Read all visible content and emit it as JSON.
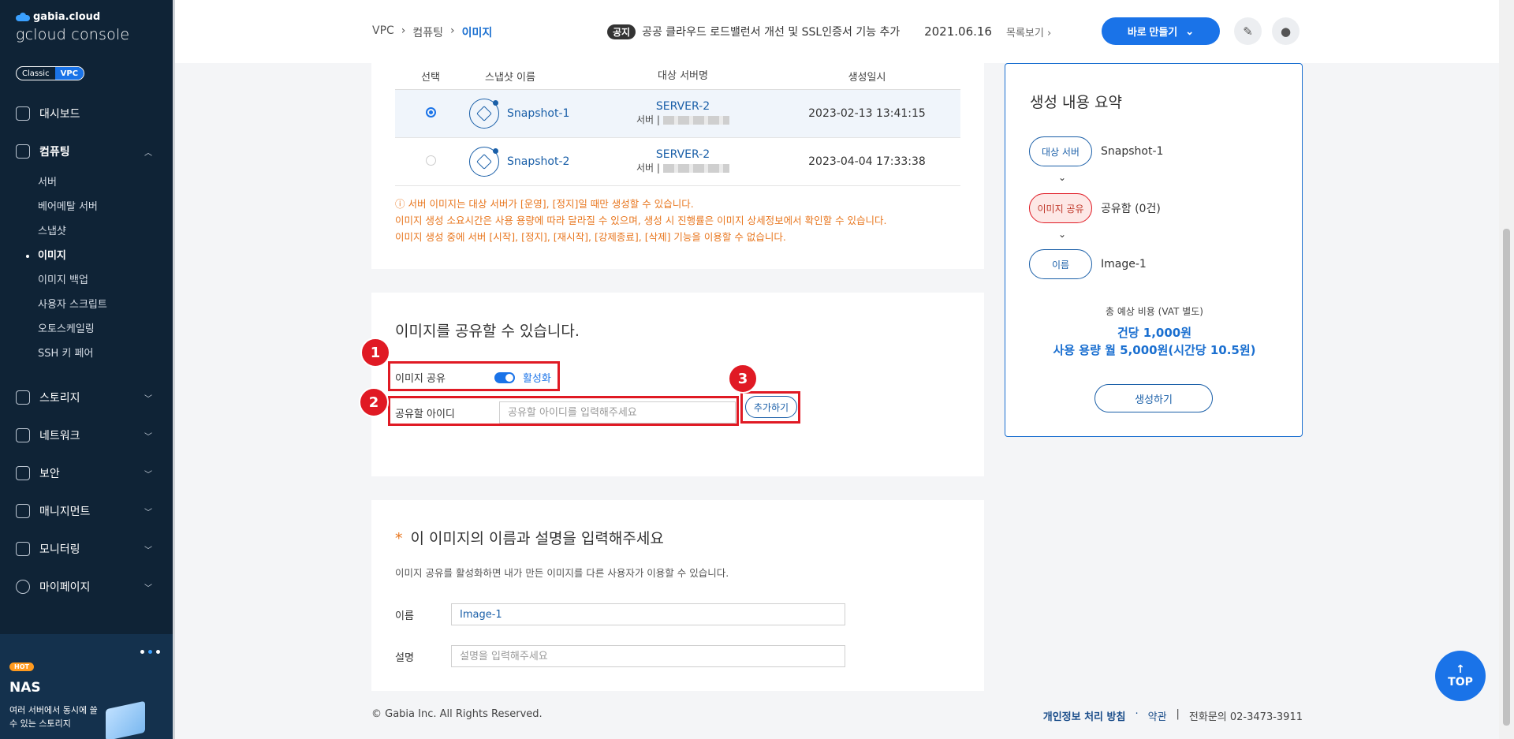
{
  "brand": {
    "small": "gabia.cloud",
    "big": "gcloud console"
  },
  "mode": {
    "classic": "Classic",
    "vpc": "VPC"
  },
  "nav": {
    "dashboard": "대시보드",
    "computing": "컴퓨팅",
    "sub": [
      "서버",
      "베어메탈 서버",
      "스냅샷",
      "이미지",
      "이미지 백업",
      "사용자 스크립트",
      "오토스케일링",
      "SSH 키 페어"
    ],
    "storage": "스토리지",
    "network": "네트워크",
    "security": "보안",
    "management": "매니지먼트",
    "monitoring": "모니터링",
    "mypage": "마이페이지"
  },
  "promo": {
    "badge": "HOT",
    "title": "NAS",
    "desc": "여러 서버에서 동시에 쓸 수 있는 스토리지"
  },
  "breadcrumb": [
    "VPC",
    "컴퓨팅",
    "이미지"
  ],
  "notice": {
    "badge": "공지",
    "text": "공공 클라우드 로드밸런서 개선 및 SSL인증서 기능 추가",
    "date": "2021.06.16",
    "more": "목록보기"
  },
  "header": {
    "create_button": "바로 만들기"
  },
  "table": {
    "headers": [
      "선택",
      "스냅샷 이름",
      "대상 서버명",
      "생성일시"
    ],
    "rows": [
      {
        "name": "Snapshot-1",
        "server": "SERVER-2",
        "server_sub": "서버 |",
        "created": "2023-02-13 13:41:15"
      },
      {
        "name": "Snapshot-2",
        "server": "SERVER-2",
        "server_sub": "서버 |",
        "created": "2023-04-04 17:33:38"
      }
    ]
  },
  "warnings": [
    "ⓘ 서버 이미지는 대상 서버가 [운영], [정지]일 때만 생성할 수 있습니다.",
    "이미지 생성 소요시간은 사용 용량에 따라 달라질 수 있으며, 생성 시 진행률은 이미지 상세정보에서 확인할 수 있습니다.",
    "이미지 생성 중에 서버 [시작], [정지], [재시작], [강제종료], [삭제] 기능을 이용할 수 없습니다."
  ],
  "share": {
    "title": "이미지를 공유할 수 있습니다.",
    "toggle_label": "이미지 공유",
    "toggle_state": "활성화",
    "id_label": "공유할 아이디",
    "id_placeholder": "공유할 아이디를 입력해주세요",
    "add_button": "추가하기",
    "badges": [
      "1",
      "2",
      "3"
    ]
  },
  "name_section": {
    "star": "*",
    "title": "이 이미지의 이름과 설명을 입력해주세요",
    "desc": "이미지 공유를 활성화하면 내가 만든 이미지를 다른 사용자가 이용할 수 있습니다.",
    "name_label": "이름",
    "name_value": "Image-1",
    "desc_label": "설명",
    "desc_placeholder": "설명을 입력해주세요"
  },
  "summary": {
    "title": "생성 내용 요약",
    "steps": [
      {
        "pill": "대상 서버",
        "value": "Snapshot-1"
      },
      {
        "pill": "이미지 공유",
        "value": "공유함 (0건)"
      },
      {
        "pill": "이름",
        "value": "Image-1"
      }
    ],
    "cost_label": "총 예상 비용 (VAT 별도)",
    "cost_1": "건당 1,000원",
    "cost_2": "사용 용량 월 5,000원(시간당 10.5원)",
    "button": "생성하기"
  },
  "footer": {
    "copyright": "© Gabia Inc. All Rights Reserved.",
    "privacy": "개인정보 처리 방침",
    "dot": "·",
    "terms": "약관",
    "bar": "|",
    "phone": "전화문의  02-3473-3911"
  },
  "top_button": "TOP",
  "colors": {
    "accent": "#1a73e8",
    "sidebar": "#0f2336",
    "warning": "#e8761e",
    "highlight": "#e01a24"
  }
}
